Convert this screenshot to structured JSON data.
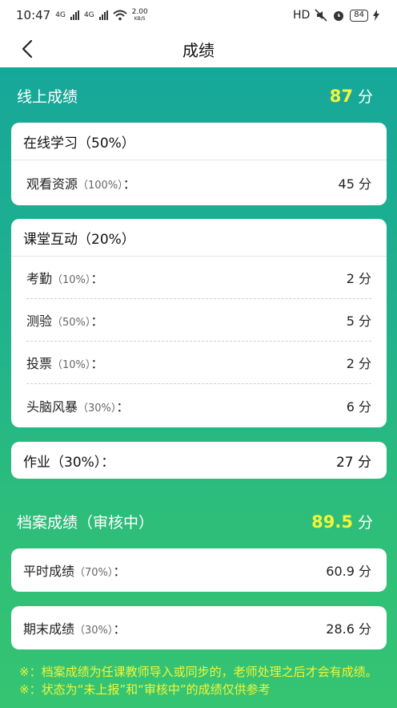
{
  "status": {
    "time": "10:47",
    "net1": "4G",
    "net2": "4G",
    "speed_num": "2.00",
    "speed_unit": "KB/S",
    "hd": "HD",
    "battery": "84"
  },
  "nav": {
    "title": "成绩"
  },
  "online": {
    "title": "线上成绩",
    "score": "87",
    "unit": "分",
    "study": {
      "title": "在线学习（50%）",
      "rows": [
        {
          "label": "观看资源",
          "pct": "（100%）",
          "colon": "：",
          "value": "45 分"
        }
      ]
    },
    "interaction": {
      "title": "课堂互动（20%）",
      "rows": [
        {
          "label": "考勤",
          "pct": "（10%）",
          "colon": "：",
          "value": "2 分"
        },
        {
          "label": "测验",
          "pct": "（50%）",
          "colon": "：",
          "value": "5 分"
        },
        {
          "label": "投票",
          "pct": "（10%）",
          "colon": "：",
          "value": "2 分"
        },
        {
          "label": "头脑风暴",
          "pct": "（30%）",
          "colon": "：",
          "value": "6 分"
        }
      ]
    },
    "homework": {
      "label": "作业（30%）：",
      "value": "27 分"
    }
  },
  "archive": {
    "title": "档案成绩（审核中）",
    "score": "89.5",
    "unit": "分",
    "rows": [
      {
        "label": "平时成绩",
        "pct": "（70%）",
        "colon": "：",
        "value": "60.9 分"
      },
      {
        "label": "期末成绩",
        "pct": "（30%）",
        "colon": "：",
        "value": "28.6 分"
      }
    ]
  },
  "notes": {
    "line1": "※：档案成绩为任课教师导入或同步的，老师处理之后才会有成绩。",
    "line2": "※：状态为“未上报”和“审核中”的成绩仅供参考"
  }
}
